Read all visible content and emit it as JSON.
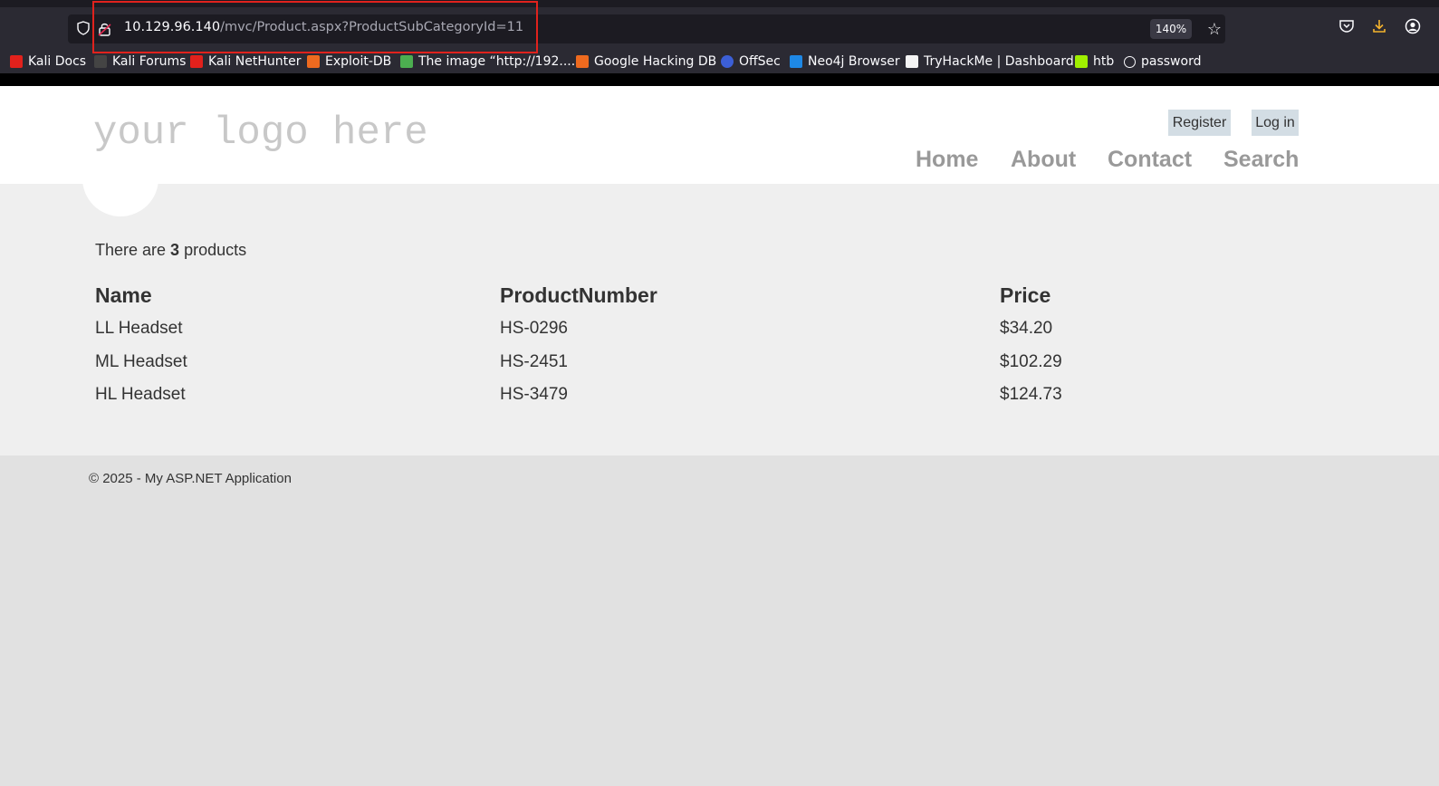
{
  "browser": {
    "url_host": "10.129.96.140",
    "url_path": "/mvc/Product.aspx?ProductSubCategoryId=11",
    "zoom": "140%",
    "bookmarks": [
      {
        "label": "Kali Docs",
        "color": "#e2211c"
      },
      {
        "label": "Kali Forums",
        "color": "#1c1b22"
      },
      {
        "label": "Kali NetHunter",
        "color": "#e2211c"
      },
      {
        "label": "Exploit-DB",
        "color": "#ee6a1f"
      },
      {
        "label": "The image “http://192....",
        "color": "#4caf50"
      },
      {
        "label": "Google Hacking DB",
        "color": "#ee6a1f"
      },
      {
        "label": "OffSec",
        "color": "#3c5fd6"
      },
      {
        "label": "Neo4j Browser",
        "color": "#1e88e5"
      },
      {
        "label": "TryHackMe | Dashboard",
        "color": "#f4f4f4"
      },
      {
        "label": "htb",
        "color": "#9fef00"
      },
      {
        "label": "password",
        "color": "#fbfbfe"
      }
    ]
  },
  "site": {
    "logo_text": "your logo here",
    "register_label": "Register",
    "login_label": "Log in",
    "nav": [
      "Home",
      "About",
      "Contact",
      "Search"
    ]
  },
  "products": {
    "summary_prefix": "There are ",
    "count": "3",
    "summary_suffix": " products",
    "headers": [
      "Name",
      "ProductNumber",
      "Price"
    ],
    "rows": [
      [
        "LL Headset",
        "HS-0296",
        "$34.20"
      ],
      [
        "ML Headset",
        "HS-2451",
        "$102.29"
      ],
      [
        "HL Headset",
        "HS-3479",
        "$124.73"
      ]
    ]
  },
  "footer": {
    "text": "© 2025 - My ASP.NET Application"
  }
}
